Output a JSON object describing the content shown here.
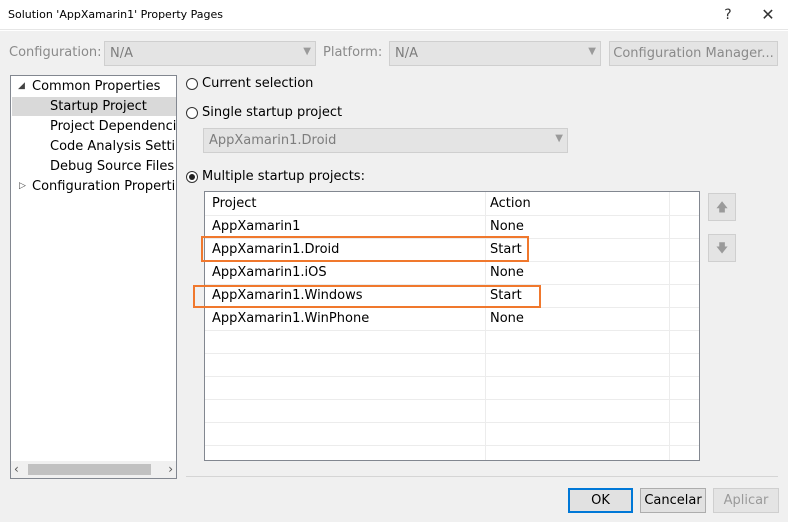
{
  "window": {
    "title": "Solution 'AppXamarin1' Property Pages",
    "help_label": "?",
    "close_label": "✕"
  },
  "config_bar": {
    "configuration_label": "Configuration:",
    "configuration_value": "N/A",
    "platform_label": "Platform:",
    "platform_value": "N/A",
    "config_manager_label": "Configuration Manager..."
  },
  "tree": {
    "common_properties": "Common Properties",
    "items": [
      {
        "label": "Startup Project"
      },
      {
        "label": "Project Dependencie"
      },
      {
        "label": "Code Analysis Setting"
      },
      {
        "label": "Debug Source Files"
      }
    ],
    "configuration_properties": "Configuration Properties",
    "selected": "Startup Project"
  },
  "startup": {
    "current_selection_label": "Current selection",
    "single_startup_label": "Single startup project",
    "single_startup_value": "AppXamarin1.Droid",
    "multiple_startup_label": "Multiple startup projects:",
    "selected_option": "Multiple startup projects:"
  },
  "grid": {
    "headers": {
      "project": "Project",
      "action": "Action"
    },
    "rows": [
      {
        "project": "AppXamarin1",
        "action": "None"
      },
      {
        "project": "AppXamarin1.Droid",
        "action": "Start"
      },
      {
        "project": "AppXamarin1.iOS",
        "action": "None"
      },
      {
        "project": "AppXamarin1.Windows",
        "action": "Start"
      },
      {
        "project": "AppXamarin1.WinPhone",
        "action": "None"
      }
    ]
  },
  "buttons": {
    "ok": "OK",
    "cancel": "Cancelar",
    "apply": "Aplicar"
  },
  "colors": {
    "highlight": "#f0782d",
    "ok_border": "#0078d7"
  }
}
